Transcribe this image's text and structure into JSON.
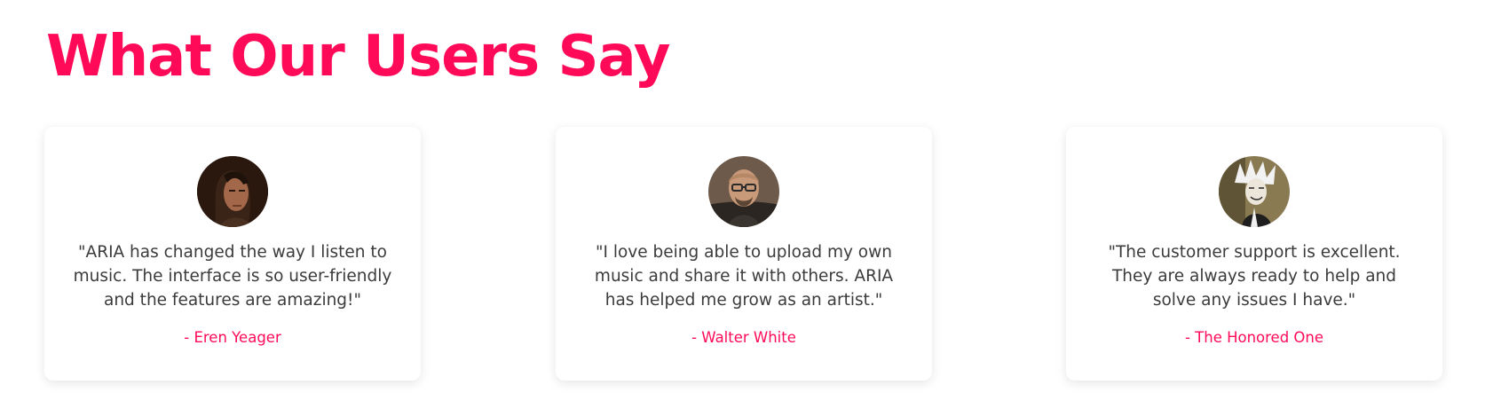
{
  "section": {
    "title": "What Our Users Say"
  },
  "testimonials": [
    {
      "quote": "\"ARIA has changed the way I listen to music. The interface is so user-friendly and the features are amazing!\"",
      "author": "- Eren Yeager",
      "avatar_icon": "avatar-long-hair-portrait"
    },
    {
      "quote": "\"I love being able to upload my own music and share it with others. ARIA has helped me grow as an artist.\"",
      "author": "- Walter White",
      "avatar_icon": "avatar-bald-glasses-portrait"
    },
    {
      "quote": "\"The customer support is excellent. They are always ready to help and solve any issues I have.\"",
      "author": "- The Honored One",
      "avatar_icon": "avatar-white-hair-portrait"
    }
  ],
  "colors": {
    "accent": "#ff0a59",
    "text": "#3b3b3b",
    "card_background": "#ffffff"
  }
}
